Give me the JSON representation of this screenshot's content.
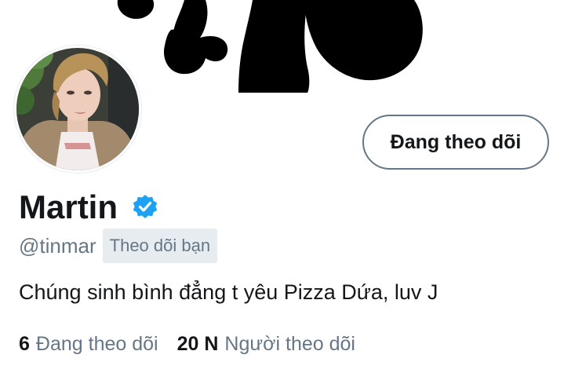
{
  "profile": {
    "display_name": "Martin",
    "handle": "@tinmar",
    "follows_you_label": "Theo dõi bạn",
    "bio": "Chúng sinh bình đẳng t yêu Pizza Dứa, luv J",
    "verified": true
  },
  "actions": {
    "follow_button_label": "Đang theo dõi"
  },
  "stats": {
    "following_count": "6",
    "following_label": "Đang theo dõi",
    "followers_count": "20 N",
    "followers_label": "Người theo dõi"
  },
  "colors": {
    "accent": "#1da1f2",
    "text_primary": "#14171a",
    "text_secondary": "#657786",
    "chip_bg": "#e6ecf0"
  },
  "icons": {
    "verified": "verified-badge-icon"
  }
}
